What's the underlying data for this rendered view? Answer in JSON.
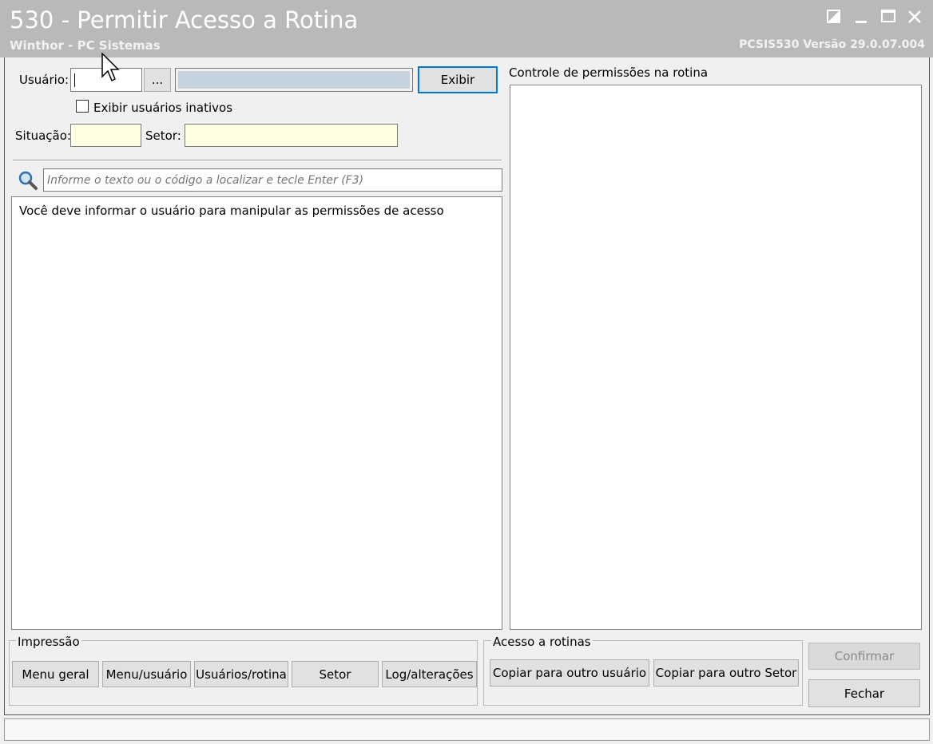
{
  "window": {
    "title": "530 - Permitir Acesso a Rotina",
    "subtitle": "Winthor - PC Sistemas",
    "version": "PCSIS530  Versão  29.0.07.004"
  },
  "colors": {
    "titlebar": "#b9b9b9",
    "input_yellow": "#ffffe1",
    "name_field": "#c5d3df"
  },
  "form": {
    "usuario_label": "Usuário:",
    "usuario_value": "",
    "lookup_button": "...",
    "usuario_name": "",
    "exibir_button": "Exibir",
    "inativos_checkbox": "Exibir usuários inativos",
    "inativos_checked": false,
    "situacao_label": "Situação:",
    "situacao_value": "",
    "setor_label": "Setor:",
    "setor_value": ""
  },
  "search": {
    "icon": "magnifier-icon",
    "placeholder": "Informe o texto ou o código a localizar e tecle Enter (F3)"
  },
  "left_panel": {
    "message": "Você deve informar o usuário para manipular as permissões de acesso"
  },
  "right_panel": {
    "label": "Controle de permissões na rotina"
  },
  "impressao": {
    "legend": "Impressão",
    "buttons": [
      "Menu geral",
      "Menu/usuário",
      "Usuários/rotina",
      "Setor",
      "Log/alterações"
    ]
  },
  "acesso": {
    "legend": "Acesso a rotinas",
    "buttons": [
      "Copiar para outro usuário",
      "Copiar para outro Setor"
    ]
  },
  "actions": {
    "confirmar": "Confirmar",
    "confirmar_enabled": false,
    "fechar": "Fechar"
  },
  "statusbar": {
    "text": ""
  }
}
